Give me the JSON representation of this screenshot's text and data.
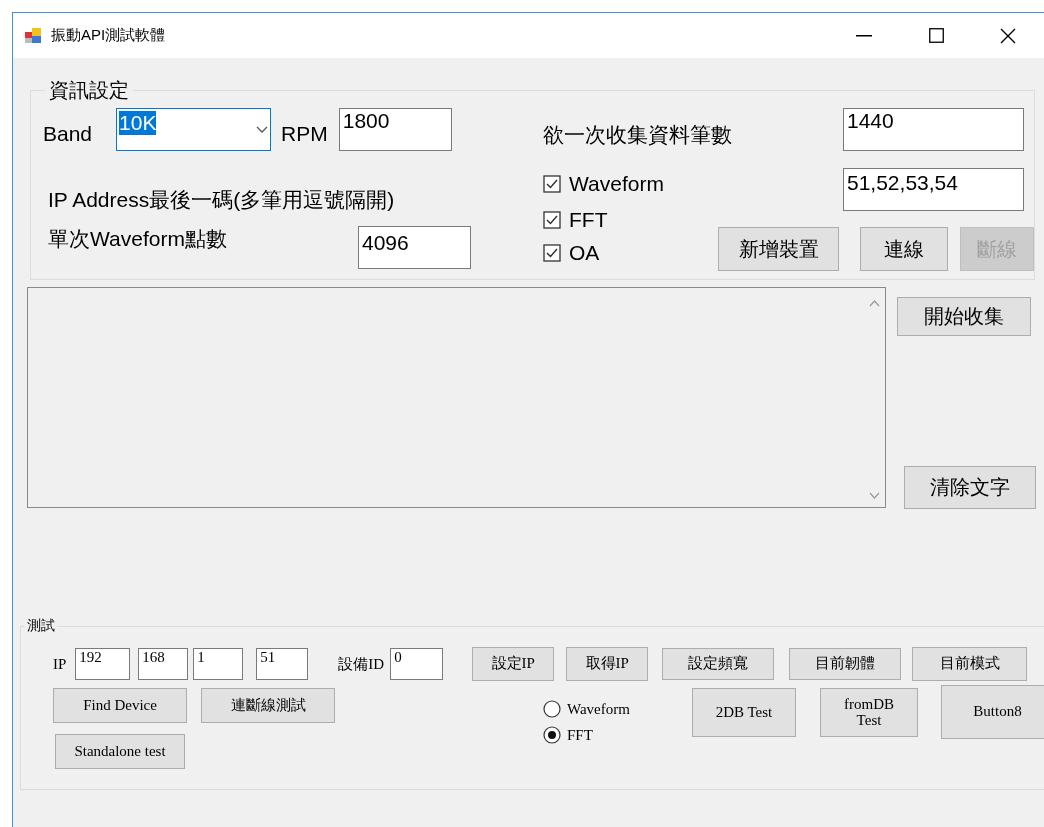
{
  "window": {
    "title": "振動API測試軟體"
  },
  "settings": {
    "title": "資訊設定",
    "band_label": "Band",
    "band_value": "10K",
    "band_value_selected": true,
    "rpm_label": "RPM",
    "rpm_value": "1800",
    "ip_label": "IP Address最後一碼(多筆用逗號隔開)",
    "points_label": "單次Waveform點數",
    "points_value": "4096",
    "count_label": "欲一次收集資料筆數",
    "count_value": "1440",
    "ip_list_value": "51,52,53,54",
    "checkboxes": [
      {
        "label": "Waveform",
        "checked": true
      },
      {
        "label": "FFT",
        "checked": true
      },
      {
        "label": "OA",
        "checked": true
      }
    ],
    "buttons": [
      {
        "label": "新增裝置",
        "disabled": false
      },
      {
        "label": "連線",
        "disabled": false
      },
      {
        "label": "斷線",
        "disabled": true
      }
    ]
  },
  "log": {
    "buttons": [
      {
        "label": "開始收集"
      },
      {
        "label": "清除文字"
      }
    ]
  },
  "test": {
    "title": "測試",
    "ip_label": "IP",
    "ip_parts": [
      "192",
      "168",
      "1",
      "51"
    ],
    "device_id_label": "設備ID",
    "device_id_value": "0",
    "row1_buttons": [
      {
        "label": "設定IP"
      },
      {
        "label": "取得IP"
      },
      {
        "label": "設定頻寬"
      },
      {
        "label": "目前韌體"
      },
      {
        "label": "目前模式"
      }
    ],
    "left_buttons": [
      {
        "label": "Find Device"
      },
      {
        "label": "連斷線測試"
      },
      {
        "label": "Standalone test"
      }
    ],
    "radios": [
      {
        "label": "Waveform",
        "selected": false
      },
      {
        "label": "FFT",
        "selected": true
      }
    ],
    "row2_buttons": [
      {
        "label": "2DB Test"
      },
      {
        "label": "fromDB Test"
      },
      {
        "label": "Button8"
      }
    ]
  }
}
